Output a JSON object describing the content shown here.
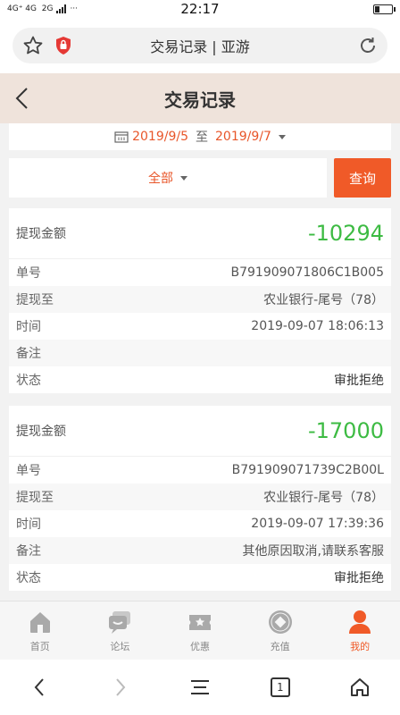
{
  "statusbar": {
    "network": "4G⁺ 4G  2G",
    "time": "22:17",
    "more": "···"
  },
  "browser": {
    "title": "交易记录 | 亚游"
  },
  "header": {
    "title": "交易记录"
  },
  "filter": {
    "start_date": "2019/9/5",
    "to_label": "至",
    "end_date": "2019/9/7",
    "type": "全部",
    "query_label": "查询"
  },
  "records": [
    {
      "amount_label": "提现金额",
      "amount": "-10294",
      "rows": [
        {
          "label": "单号",
          "value": "B791909071806C1B005"
        },
        {
          "label": "提现至",
          "value": "农业银行-尾号（78）"
        },
        {
          "label": "时间",
          "value": "2019-09-07 18:06:13"
        },
        {
          "label": "备注",
          "value": ""
        },
        {
          "label": "状态",
          "value": "审批拒绝"
        }
      ]
    },
    {
      "amount_label": "提现金额",
      "amount": "-17000",
      "rows": [
        {
          "label": "单号",
          "value": "B791909071739C2B00L"
        },
        {
          "label": "提现至",
          "value": "农业银行-尾号（78）"
        },
        {
          "label": "时间",
          "value": "2019-09-07 17:39:36"
        },
        {
          "label": "备注",
          "value": "其他原因取消,请联系客服"
        },
        {
          "label": "状态",
          "value": "审批拒绝"
        }
      ]
    }
  ],
  "tabs": [
    {
      "label": "首页",
      "icon": "home-icon"
    },
    {
      "label": "论坛",
      "icon": "forum-icon"
    },
    {
      "label": "优惠",
      "icon": "promo-icon"
    },
    {
      "label": "充值",
      "icon": "deposit-icon"
    },
    {
      "label": "我的",
      "icon": "profile-icon",
      "active": true
    }
  ],
  "browser_nav": {
    "tab_count": "1"
  },
  "colors": {
    "accent": "#f05a28",
    "amount": "#3dbb43",
    "header_bg": "#efe3db"
  }
}
